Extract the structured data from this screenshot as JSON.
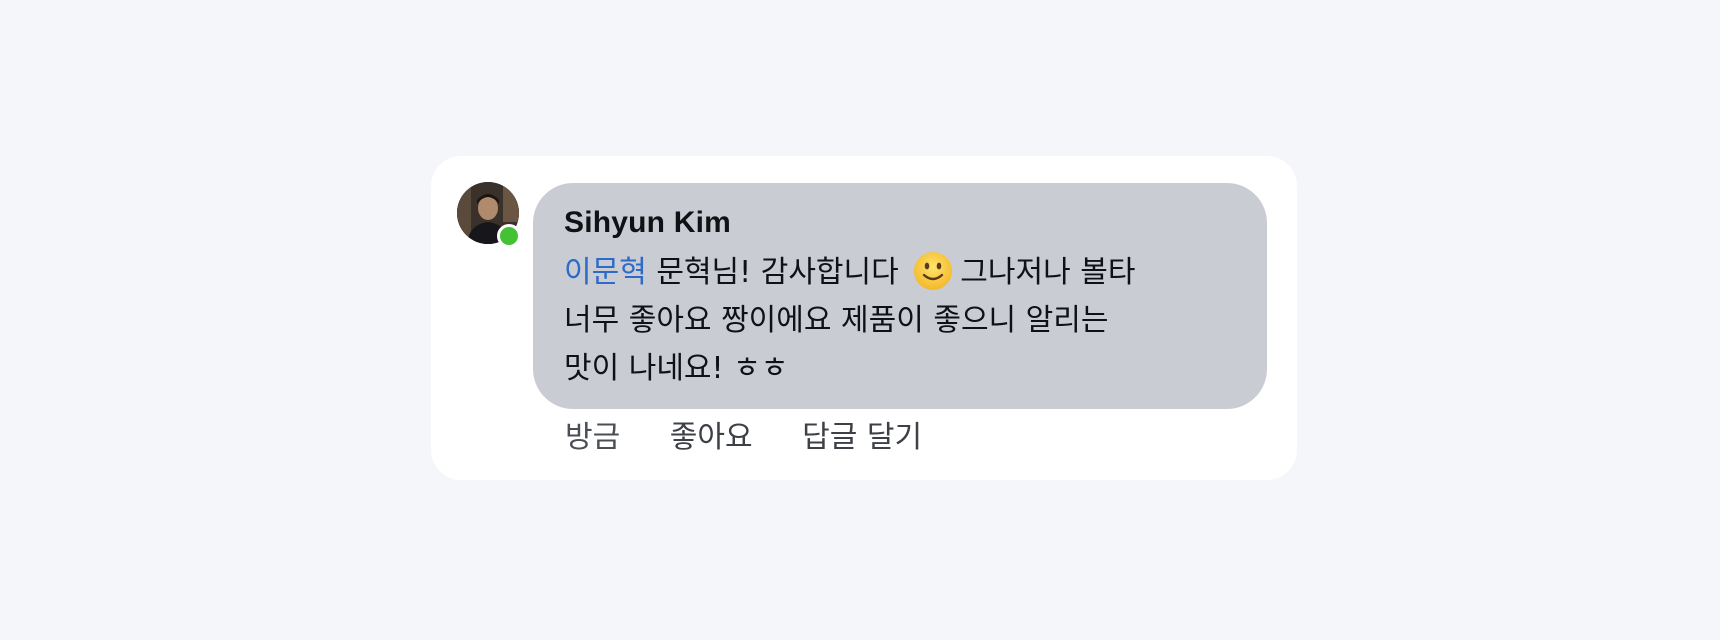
{
  "comment": {
    "author": "Sihyun Kim",
    "mention": "이문혁",
    "line1_after_mention": "문혁님! 감사합니다",
    "line1_after_emoji": "그나저나 볼타",
    "line2": "너무 좋아요 짱이에요 제품이 좋으니 알리는",
    "line3": "맛이 나네요! ㅎㅎ",
    "emoji_icon": "slightly-smiling-face-icon",
    "online": true,
    "colors": {
      "bubble": "#c9ccd2",
      "mention": "#2d6bc8",
      "online_dot": "#45c134",
      "page_background": "#f5f6fa"
    }
  },
  "actions": {
    "timestamp": "방금",
    "like_label": "좋아요",
    "reply_label": "답글 달기"
  }
}
